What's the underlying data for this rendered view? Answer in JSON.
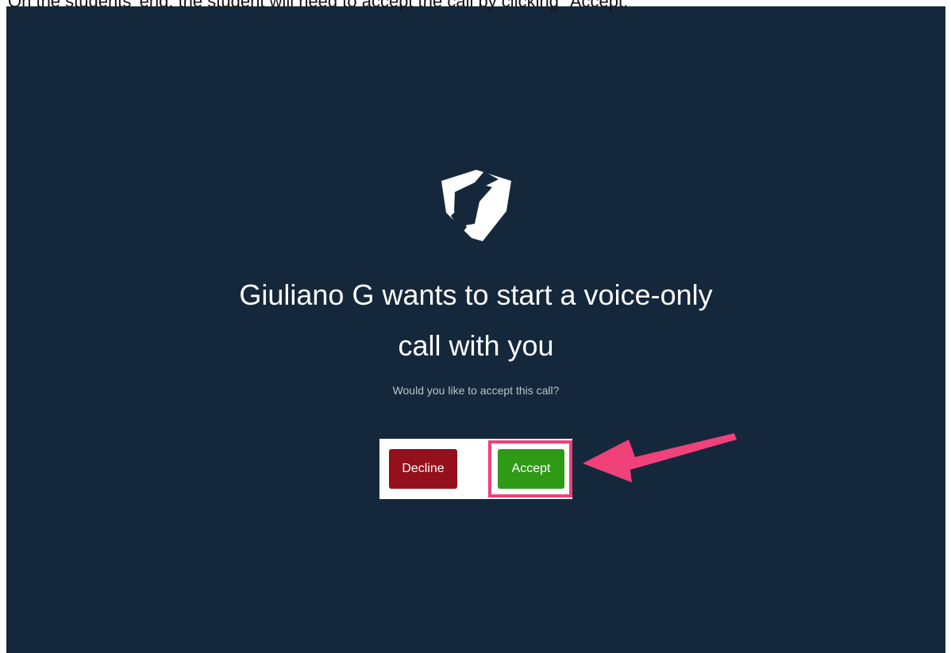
{
  "caption": "On the students' end, the student will need to accept the call by clicking \"Accept.\"",
  "call_prompt": {
    "logo_icon": "shield-logo-icon",
    "headline_line1": "Giuliano G wants to start a voice-only",
    "headline_line2": "call with you",
    "subtitle": "Would you like to accept this call?",
    "decline_label": "Decline",
    "accept_label": "Accept"
  },
  "annotation": {
    "arrow_icon": "pointer-arrow-icon",
    "highlight_color": "#f0417a"
  },
  "colors": {
    "background": "#15283b",
    "decline": "#94101c",
    "accept": "#2e9a16"
  }
}
